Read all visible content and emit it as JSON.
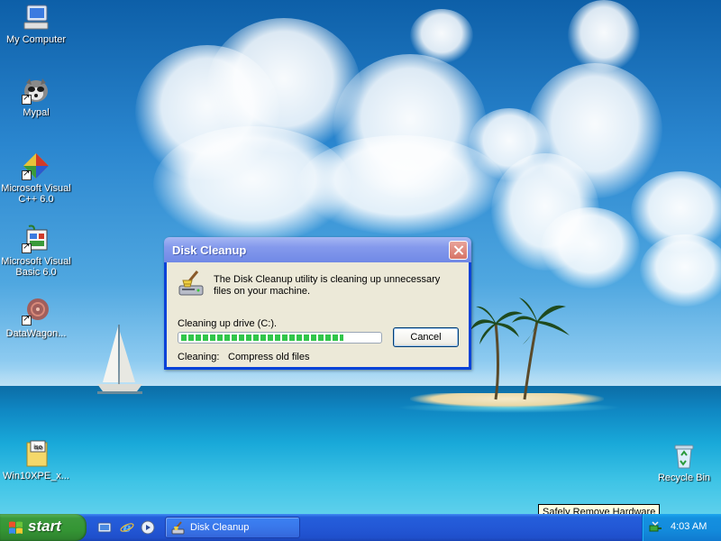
{
  "desktop": {
    "icons": [
      {
        "label": "My Computer",
        "icon": "my-computer-icon"
      },
      {
        "label": "Mypal",
        "icon": "mypal-raccoon-icon"
      },
      {
        "label": "Microsoft Visual C++ 6.0",
        "icon": "visual-cpp-icon"
      },
      {
        "label": "Microsoft Visual Basic 6.0",
        "icon": "visual-basic-icon"
      },
      {
        "label": "DataWagon...",
        "icon": "datawagon-icon"
      },
      {
        "label": "Win10XPE_x...",
        "icon": "iso-file-icon"
      },
      {
        "label": "Recycle Bin",
        "icon": "recycle-bin-icon"
      }
    ]
  },
  "dialog": {
    "title": "Disk Cleanup",
    "message": "The Disk Cleanup utility is cleaning up unnecessary files on your machine.",
    "drive_label": "Cleaning up drive  (C:).",
    "progress": 0.82,
    "cancel_label": "Cancel",
    "status_label": "Cleaning:",
    "status_value": "Compress old files",
    "icon": "disk-cleanup-icon"
  },
  "tooltip": {
    "text": "Safely Remove Hardware"
  },
  "taskbar": {
    "start_label": "start",
    "quick_launch": [
      {
        "icon": "show-desktop-icon"
      },
      {
        "icon": "internet-explorer-icon"
      },
      {
        "icon": "media-player-icon"
      }
    ],
    "tasks": [
      {
        "label": "Disk Cleanup",
        "icon": "disk-cleanup-icon"
      }
    ],
    "tray": {
      "icons": [
        {
          "icon": "safely-remove-hardware-icon"
        }
      ],
      "clock": "4:03 AM"
    }
  },
  "colors": {
    "titlebar": "#7089e6",
    "dialog_bg": "#ece9d8",
    "progress": "#31c64a",
    "taskbar": "#245edb",
    "start": "#3c9a3c",
    "tray": "#138bdc"
  }
}
